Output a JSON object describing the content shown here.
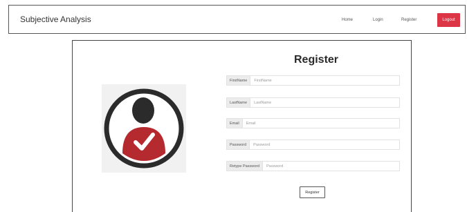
{
  "navbar": {
    "brand": "Subjective Analysis",
    "links": {
      "home": "Home",
      "login": "Login",
      "register": "Register"
    },
    "logout_label": "Logout",
    "logout_color": "#dc3545"
  },
  "form": {
    "title": "Register",
    "fields": {
      "firstname": {
        "label": "FirstName",
        "placeholder": "FirstName"
      },
      "lastname": {
        "label": "LastName",
        "placeholder": "LastName"
      },
      "email": {
        "label": "Email",
        "placeholder": "Email"
      },
      "password": {
        "label": "Password",
        "placeholder": "Password"
      },
      "retype": {
        "label": "Retype Password",
        "placeholder": "Password"
      }
    },
    "submit_label": "Register"
  },
  "icons": {
    "avatar": "user-check-icon"
  }
}
